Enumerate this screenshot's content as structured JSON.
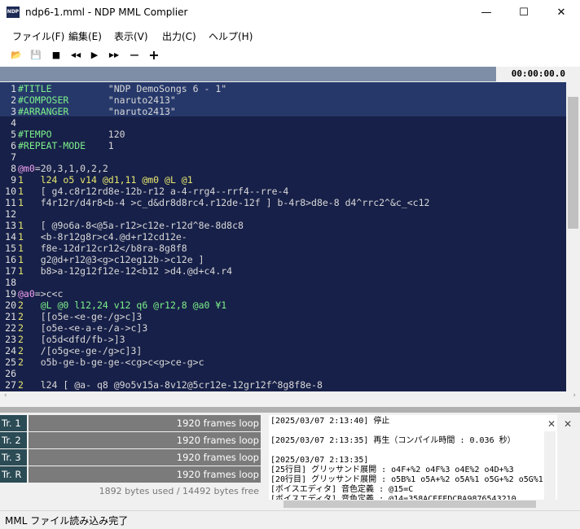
{
  "window": {
    "icon_text": "NDP",
    "title": "ndp6-1.mml - NDP MML Complier",
    "minimize": "—",
    "maximize": "☐",
    "close": "✕"
  },
  "menu": {
    "items": [
      {
        "label": "ファイル(F)"
      },
      {
        "label": "編集(E)"
      },
      {
        "label": "表示(V)"
      },
      {
        "label": "出力(C)"
      },
      {
        "label": "ヘルプ(H)"
      }
    ]
  },
  "toolbar": {
    "open": "📂",
    "save": "💾",
    "stop": "■",
    "rewind": "◀◀",
    "play": "▶",
    "forward": "▶▶",
    "minus": "—",
    "plus": "+"
  },
  "playback": {
    "time": "00:00:00.0",
    "progress": 0.855
  },
  "editor": {
    "lines": [
      {
        "n": "1",
        "segs": [
          {
            "t": "#TITLE",
            "c": "#7cf08a"
          },
          {
            "t": "          \"NDP DemoSongs 6 - 1\"",
            "c": "#d8d8d8"
          }
        ]
      },
      {
        "n": "2",
        "segs": [
          {
            "t": "#COMPOSER",
            "c": "#7cf08a"
          },
          {
            "t": "       \"naruto2413\"",
            "c": "#d8d8d8"
          }
        ]
      },
      {
        "n": "3",
        "segs": [
          {
            "t": "#ARRANGER",
            "c": "#7cf08a"
          },
          {
            "t": "       \"naruto2413\"",
            "c": "#d8d8d8"
          }
        ]
      },
      {
        "n": "4",
        "segs": []
      },
      {
        "n": "5",
        "segs": [
          {
            "t": "#TEMPO",
            "c": "#7cf08a"
          },
          {
            "t": "          120",
            "c": "#d8d8d8"
          }
        ]
      },
      {
        "n": "6",
        "segs": [
          {
            "t": "#REPEAT-MODE",
            "c": "#7cf08a"
          },
          {
            "t": "    1",
            "c": "#d8d8d8"
          }
        ]
      },
      {
        "n": "7",
        "segs": []
      },
      {
        "n": "8",
        "segs": [
          {
            "t": "@m0",
            "c": "#f0a0f0"
          },
          {
            "t": "=20,3,1,0,2,2",
            "c": "#d8d8d8"
          }
        ]
      },
      {
        "n": "9",
        "segs": [
          {
            "t": "1   ",
            "c": "#e8e870"
          },
          {
            "t": "l24 o5 v14 @d1,11 @m0 @L @1",
            "c": "#e8e870"
          }
        ]
      },
      {
        "n": "10",
        "segs": [
          {
            "t": "1   ",
            "c": "#e8e870"
          },
          {
            "t": "[ g4.c8r12rd8e-12b-r12 a-4-rrg4--rrf4--rre-4",
            "c": "#d8d8d8"
          }
        ]
      },
      {
        "n": "11",
        "segs": [
          {
            "t": "1   ",
            "c": "#e8e870"
          },
          {
            "t": "f4r12r/d4r8<b-4 >c_d&dr8d8rc4.r12de-12f ] b-4r8>d8e-8 d4^rrc2^&c_<c12",
            "c": "#d8d8d8"
          }
        ]
      },
      {
        "n": "12",
        "segs": []
      },
      {
        "n": "13",
        "segs": [
          {
            "t": "1   ",
            "c": "#e8e870"
          },
          {
            "t": "[ @9o6a-8<@5a-r12>c12e-r12d^8e-8d8c8",
            "c": "#d8d8d8"
          }
        ]
      },
      {
        "n": "14",
        "segs": [
          {
            "t": "1   ",
            "c": "#e8e870"
          },
          {
            "t": "<b-8r12g8r>c4.@d+r12cd12e-",
            "c": "#d8d8d8"
          }
        ]
      },
      {
        "n": "15",
        "segs": [
          {
            "t": "1   ",
            "c": "#e8e870"
          },
          {
            "t": "f8e-12dr12cr12</b8ra-8g8f8",
            "c": "#d8d8d8"
          }
        ]
      },
      {
        "n": "16",
        "segs": [
          {
            "t": "1   ",
            "c": "#e8e870"
          },
          {
            "t": "g2@d+r12@3<g>c12eg12b->c12e ]",
            "c": "#d8d8d8"
          }
        ]
      },
      {
        "n": "17",
        "segs": [
          {
            "t": "1   ",
            "c": "#e8e870"
          },
          {
            "t": "b8>a-12g12f12e-12<b12 >d4.@d+c4.r4",
            "c": "#d8d8d8"
          }
        ]
      },
      {
        "n": "18",
        "segs": []
      },
      {
        "n": "19",
        "segs": [
          {
            "t": "@a0",
            "c": "#f0a0f0"
          },
          {
            "t": "=>c<c",
            "c": "#d8d8d8"
          }
        ]
      },
      {
        "n": "20",
        "segs": [
          {
            "t": "2   ",
            "c": "#e8e870"
          },
          {
            "t": "@L @0 l12,24 v12 q6 @r12,8 @a0 ¥1",
            "c": "#7cf08a"
          }
        ]
      },
      {
        "n": "21",
        "segs": [
          {
            "t": "2   ",
            "c": "#e8e870"
          },
          {
            "t": "[[o5e-<e-ge-/g>c]3",
            "c": "#d8d8d8"
          }
        ]
      },
      {
        "n": "22",
        "segs": [
          {
            "t": "2   ",
            "c": "#e8e870"
          },
          {
            "t": "[o5e-<e-a-e-/a->c]3",
            "c": "#d8d8d8"
          }
        ]
      },
      {
        "n": "23",
        "segs": [
          {
            "t": "2   ",
            "c": "#e8e870"
          },
          {
            "t": "[o5d<dfd/fb->]3",
            "c": "#d8d8d8"
          }
        ]
      },
      {
        "n": "24",
        "segs": [
          {
            "t": "2   ",
            "c": "#e8e870"
          },
          {
            "t": "/[o5g<e-ge-/g>c]3]",
            "c": "#d8d8d8"
          }
        ]
      },
      {
        "n": "25",
        "segs": [
          {
            "t": "2   ",
            "c": "#e8e870"
          },
          {
            "t": "o5b-ge-b-ge-ge-<cg>c<g>ce-g>c",
            "c": "#d8d8d8"
          }
        ]
      },
      {
        "n": "26",
        "segs": []
      },
      {
        "n": "27",
        "segs": [
          {
            "t": "2   ",
            "c": "#e8e870"
          },
          {
            "t": "l24 [ @a- q8 @9o5v15a-8v12@5cr12e-12gr12f^8g8f8e-8",
            "c": "#d8d8d8"
          }
        ]
      }
    ]
  },
  "tracks": [
    {
      "label": "Tr. 1",
      "status": "1920 frames loop"
    },
    {
      "label": "Tr. 2",
      "status": "1920 frames loop"
    },
    {
      "label": "Tr. 3",
      "status": "1920 frames loop"
    },
    {
      "label": "Tr. R",
      "status": "1920 frames loop"
    }
  ],
  "memory": {
    "text": "1892 bytes used / 14492 bytes free"
  },
  "log": {
    "lines": [
      "[2025/03/07 2:13:40] 停止",
      "",
      "[2025/03/07 2:13:35] 再生（コンパイル時間 : 0.036 秒）",
      "",
      "[2025/03/07 2:13:35]",
      "[25行目] グリッサンド展開 : o4F+%2 o4F%3 o4E%2 o4D+%3",
      "[20行目] グリッサンド展開 : o5B%1 o5A+%2 o5A%1 o5G+%2 o5G%1",
      "[ボイスエディタ] 音色定義 : @15=C",
      "[ボイスエディタ] 音色定義 : @14=358ACEFEDCBA9876543210"
    ],
    "close": "✕",
    "clear": "✕"
  },
  "status": {
    "message": "MML ファイル読み込み完了"
  }
}
